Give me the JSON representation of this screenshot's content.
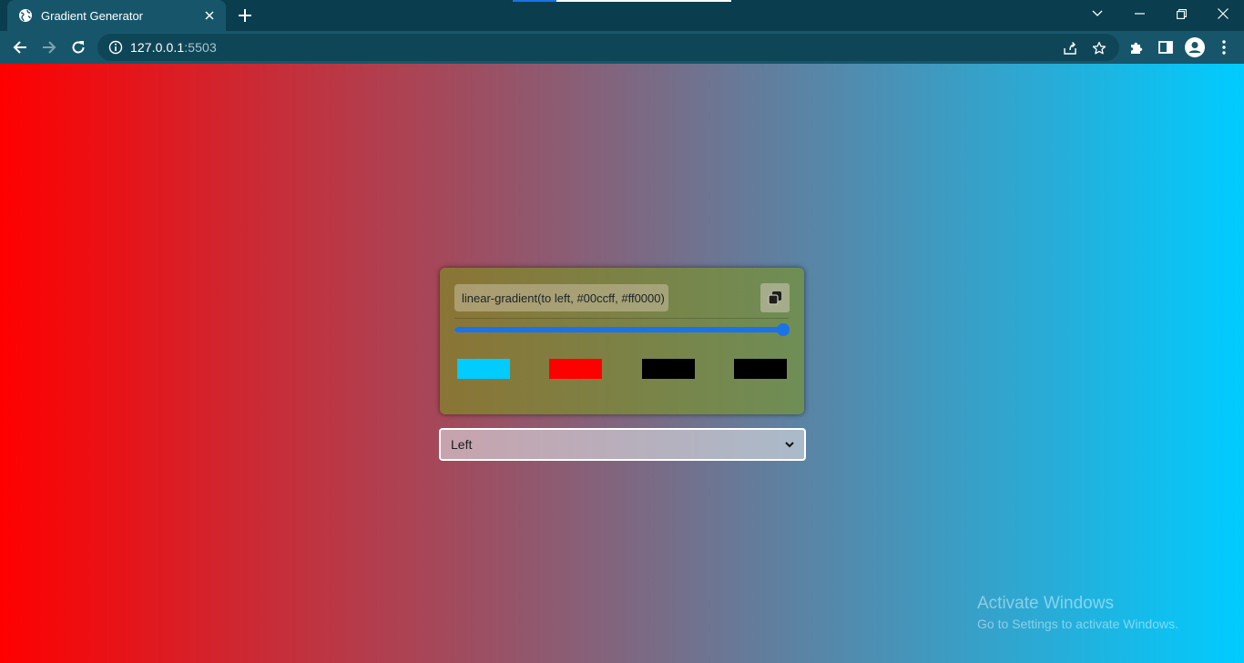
{
  "browser": {
    "tab_title": "Gradient Generator",
    "url_host": "127.0.0.1",
    "url_port": ":5503",
    "icons": [
      "globe-icon",
      "close-icon",
      "plus-icon",
      "chevron-down-icon",
      "minimize-icon",
      "restore-icon",
      "back-arrow-icon",
      "forward-arrow-icon",
      "reload-icon",
      "info-icon",
      "share-icon",
      "star-icon",
      "puzzle-icon",
      "side-panel-icon",
      "profile-icon",
      "kebab-menu-icon"
    ]
  },
  "generator": {
    "css_code": "linear-gradient(to left, #00ccff, #ff0000)",
    "copy_icon": "copy-icon",
    "slider_value_fraction": 1.0,
    "swatches": [
      {
        "color": "#00ccff"
      },
      {
        "color": "#ff0000"
      },
      {
        "color": "#000000"
      },
      {
        "color": "#000000"
      }
    ],
    "direction_selected": "Left"
  },
  "gradient": {
    "from": "#ff0000",
    "to": "#00ccff"
  },
  "watermark": {
    "line1": "Activate Windows",
    "line2": "Go to Settings to activate Windows."
  }
}
